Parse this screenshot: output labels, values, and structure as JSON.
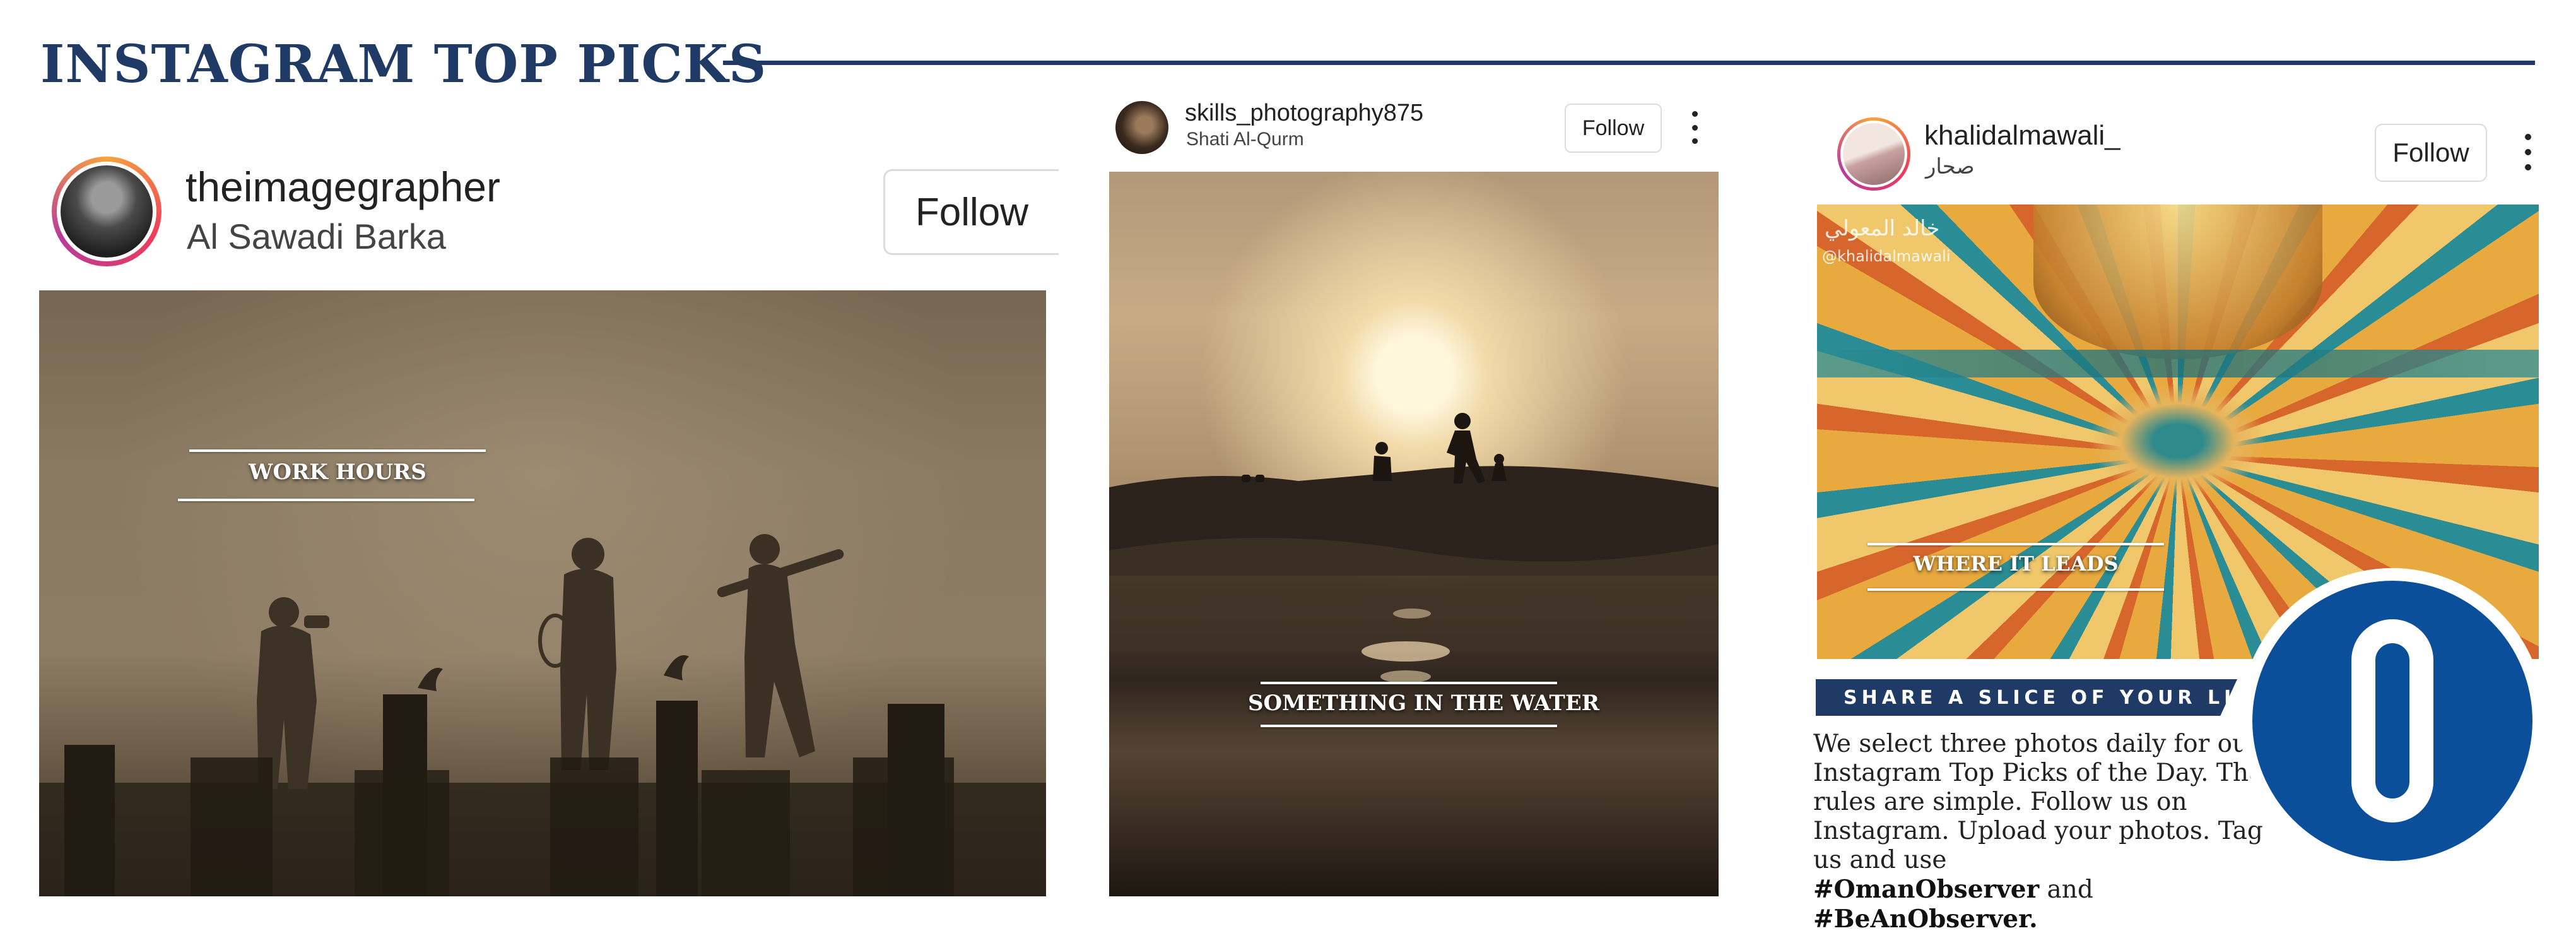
{
  "header": {
    "title": "INSTAGRAM TOP PICKS"
  },
  "posts": [
    {
      "username": "theimagegrapher",
      "location": "Al Sawadi Barka",
      "follow_label": "Follow",
      "caption": "WORK HOURS"
    },
    {
      "username": "skills_photography875",
      "location": "Shati Al-Qurm",
      "follow_label": "Follow",
      "caption": "SOMETHING IN THE WATER"
    },
    {
      "username": "khalidalmawali_",
      "location": "صحار",
      "follow_label": "Follow",
      "caption": "WHERE IT LEADS",
      "watermark_name": "خالد المعولي",
      "watermark_handle": "@khalidalmawali"
    }
  ],
  "promo": {
    "banner": "SHARE A SLICE OF YOUR LIFE",
    "body": "We select three photos daily for our Instagram Top Picks of the Day. The rules are simple. Follow us on Instagram. Upload your photos. Tag us and use",
    "hashtag1": "#OmanObserver",
    "joiner": "and",
    "hashtag2": "#BeAnObserver."
  },
  "colors": {
    "accent": "#1f3a64",
    "logo_blue": "#0b4f9a"
  }
}
